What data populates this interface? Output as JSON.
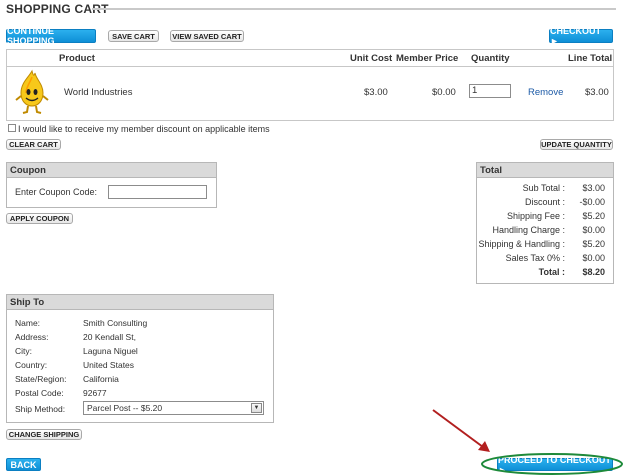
{
  "page": {
    "title": "SHOPPING CART"
  },
  "toolbar": {
    "continue_label": "CONTINUE SHOPPING",
    "save_label": "SAVE CART",
    "view_saved_label": "VIEW SAVED CART",
    "checkout_label": "CHECKOUT ►"
  },
  "cart": {
    "headers": {
      "product": "Product",
      "unit_cost": "Unit Cost",
      "member_price": "Member Price",
      "quantity": "Quantity",
      "line_total": "Line Total"
    },
    "items": [
      {
        "name": "World Industries",
        "unit_cost": "$3.00",
        "member_price": "$0.00",
        "quantity": "1",
        "remove": "Remove",
        "line_total": "$3.00"
      }
    ],
    "member_discount_label": "I would like to receive my member discount on applicable items",
    "clear_label": "CLEAR CART",
    "update_label": "UPDATE QUANTITY"
  },
  "coupon": {
    "title": "Coupon",
    "field_label": "Enter Coupon Code:",
    "value": "",
    "apply_label": "APPLY COUPON"
  },
  "totals": {
    "title": "Total",
    "rows": [
      {
        "label": "Sub Total :",
        "value": "$3.00"
      },
      {
        "label": "Discount :",
        "value": "-$0.00"
      },
      {
        "label": "Shipping Fee :",
        "value": "$5.20"
      },
      {
        "label": "Handling Charge :",
        "value": "$0.00"
      },
      {
        "label": "Shipping & Handling :",
        "value": "$5.20"
      },
      {
        "label": "Sales Tax 0% :",
        "value": "$0.00"
      },
      {
        "label": "Total :",
        "value": "$8.20"
      }
    ]
  },
  "ship_to": {
    "title": "Ship To",
    "rows": [
      {
        "label": "Name:",
        "value": "Smith Consulting"
      },
      {
        "label": "Address:",
        "value": "20 Kendall St,"
      },
      {
        "label": "City:",
        "value": "Laguna Niguel"
      },
      {
        "label": "Country:",
        "value": "United States"
      },
      {
        "label": "State/Region:",
        "value": "California"
      },
      {
        "label": "Postal Code:",
        "value": "92677"
      }
    ],
    "method_label": "Ship Method:",
    "method_value": "Parcel Post -- $5.20",
    "change_label": "CHANGE SHIPPING"
  },
  "footer": {
    "back_label": "BACK",
    "proceed_label": "PROCEED TO CHECKOUT ►"
  },
  "colors": {
    "accent": "#1a9fe3",
    "annotation_arrow": "#b21f1f",
    "annotation_circle": "#1e8a3a"
  }
}
